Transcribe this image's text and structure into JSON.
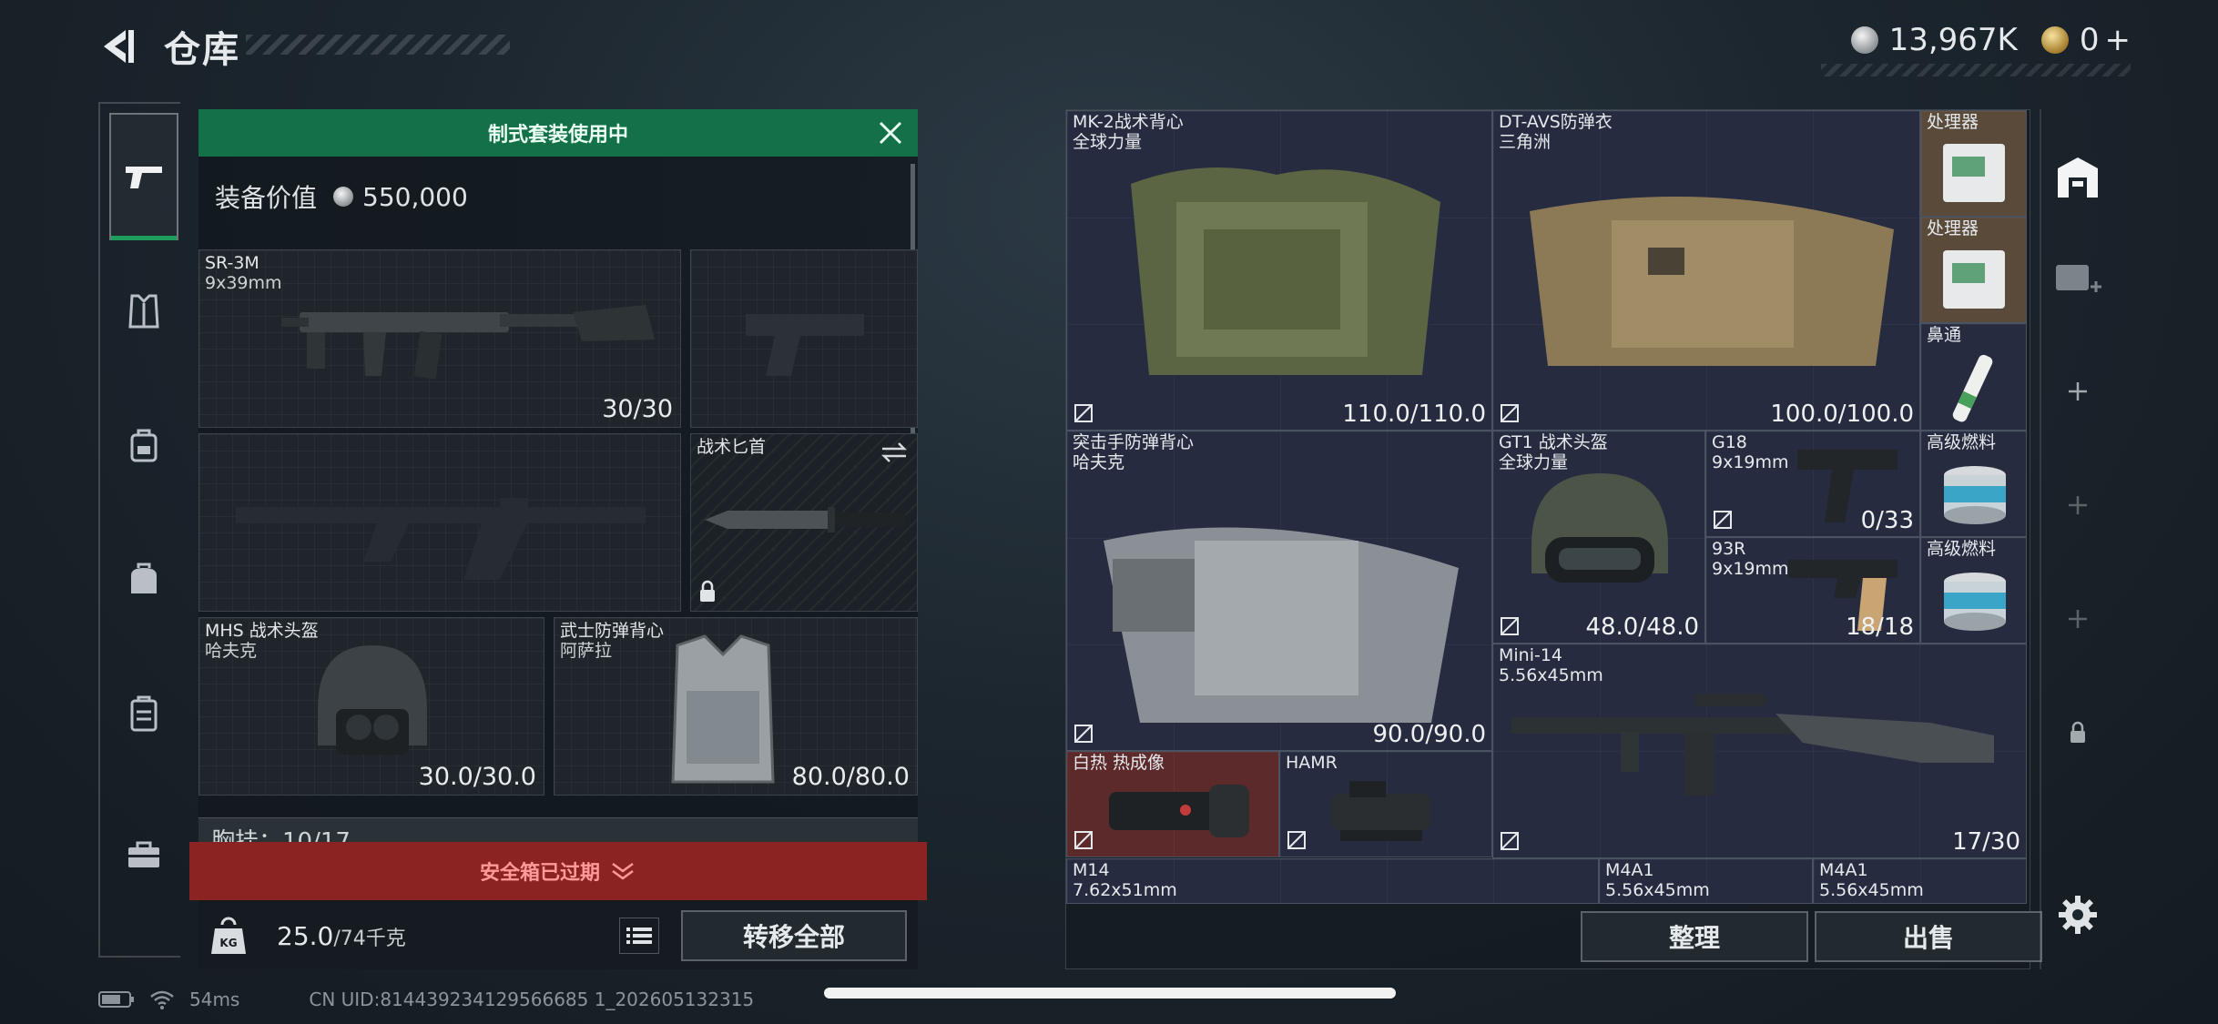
{
  "header": {
    "title": "仓库"
  },
  "currency": {
    "silver": "13,967K",
    "gold": "0",
    "gold_add": "+"
  },
  "loadout": {
    "kit_banner": "制式套装使用中",
    "value_label": "装备价值",
    "value": "550,000",
    "primary": {
      "name": "SR-3M",
      "ammo_type": "9x39mm",
      "ammo": "30/30"
    },
    "melee": {
      "name": "战术匕首"
    },
    "helmet": {
      "name": "MHS 战术头盔",
      "brand": "哈夫克",
      "durability": "30.0/30.0"
    },
    "armor": {
      "name": "武士防弹背心",
      "brand": "阿萨拉",
      "durability": "80.0/80.0"
    },
    "pocket_label": "胸挂：10/17",
    "safe_box_banner": "安全箱已过期",
    "weight": "25.0",
    "weight_max": "/74千克",
    "transfer_all": "转移全部"
  },
  "stash": {
    "items": [
      {
        "name": "MK-2战术背心",
        "brand": "全球力量",
        "value": "110.0/110.0"
      },
      {
        "name": "DT-AVS防弹衣",
        "brand": "三角洲",
        "value": "100.0/100.0"
      },
      {
        "name": "处理器"
      },
      {
        "name": "处理器"
      },
      {
        "name": "鼻通"
      },
      {
        "name": "突击手防弹背心",
        "brand": "哈夫克",
        "value": "90.0/90.0"
      },
      {
        "name": "GT1 战术头盔",
        "brand": "全球力量",
        "value": "48.0/48.0"
      },
      {
        "name": "G18",
        "ammo_type": "9x19mm",
        "value": "0/33"
      },
      {
        "name": "高级燃料"
      },
      {
        "name": "93R",
        "ammo_type": "9x19mm",
        "value": "18/18"
      },
      {
        "name": "高级燃料"
      },
      {
        "name": "Mini-14",
        "ammo_type": "5.56x45mm",
        "value": "17/30"
      },
      {
        "name": "白热 热成像"
      },
      {
        "name": "HAMR"
      },
      {
        "name": "M14",
        "ammo_type": "7.62x51mm"
      },
      {
        "name": "M4A1",
        "ammo_type": "5.56x45mm"
      },
      {
        "name": "M4A1",
        "ammo_type": "5.56x45mm"
      }
    ],
    "sort_button": "整理",
    "sell_button": "出售"
  },
  "status_bar": {
    "ping": "54ms",
    "uid": "CN UID:814439234129566685 1_202605132315"
  },
  "colors": {
    "accent_green": "#137047",
    "alert_red": "#8c2323",
    "stash_cell": "#262b3f"
  }
}
